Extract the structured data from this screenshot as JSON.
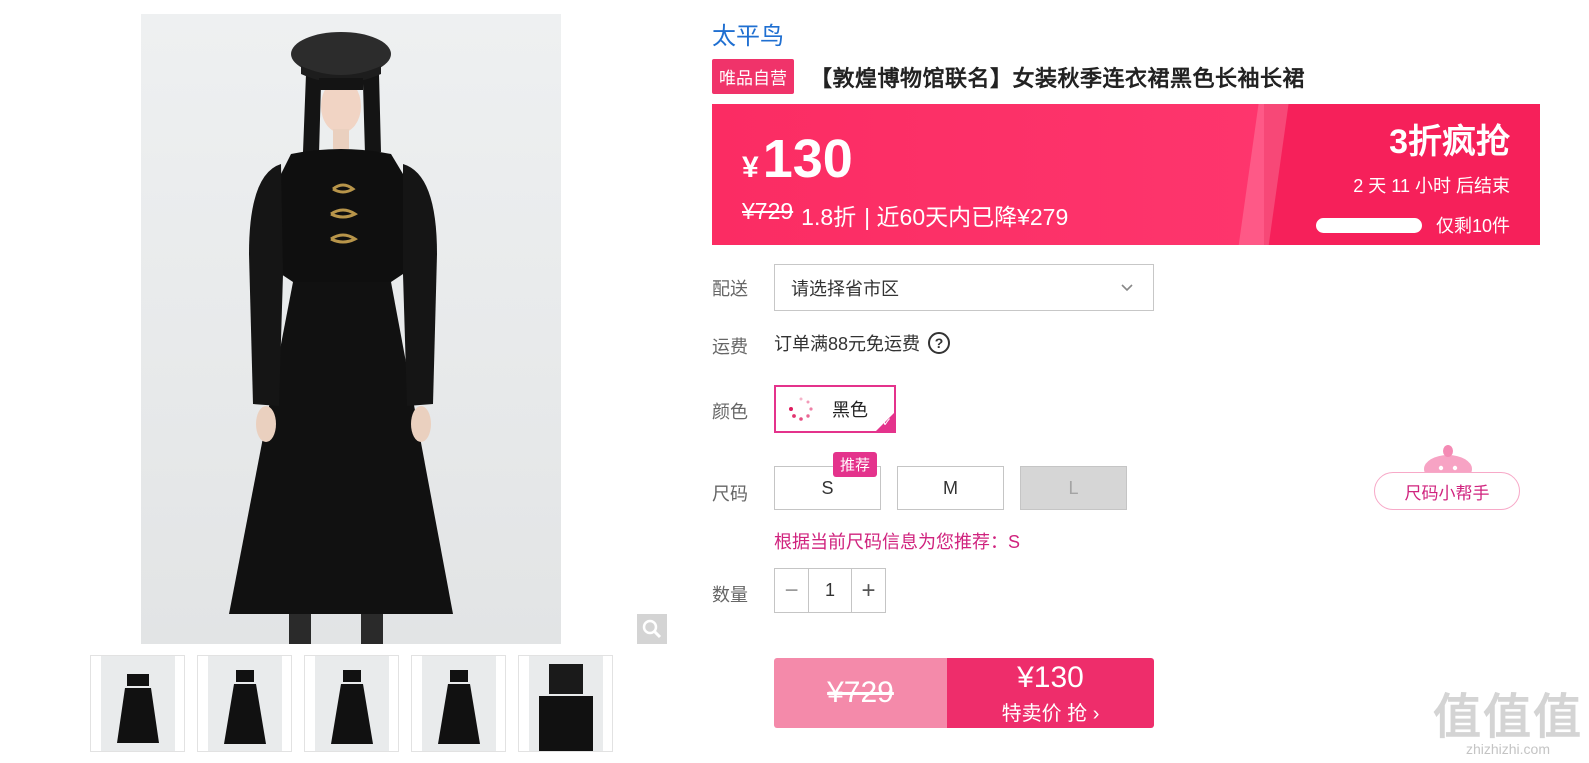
{
  "brand": "太平鸟",
  "product": {
    "self_badge": "唯品自营",
    "title": "【敦煌博物馆联名】女装秋季连衣裙黑色长袖长裙"
  },
  "price": {
    "currency": "¥",
    "current": "130",
    "original": "¥729",
    "discount": "1.8折",
    "recent_drop": "| 近60天内已降¥279",
    "promo_name": "3折疯抢",
    "countdown": "2 天 11 小时 后结束",
    "stock_remaining_fraction": 0.97,
    "stock_text": "仅剩10件"
  },
  "delivery": {
    "label": "配送",
    "placeholder": "请选择省市区"
  },
  "shipping": {
    "label": "运费",
    "text": "订单满88元免运费",
    "help_glyph": "?"
  },
  "color": {
    "label": "颜色",
    "selected": "黑色"
  },
  "size": {
    "label": "尺码",
    "options": [
      {
        "value": "S",
        "available": true
      },
      {
        "value": "M",
        "available": true
      },
      {
        "value": "L",
        "available": false
      }
    ],
    "recommend_badge": "推荐",
    "recommend_text": "根据当前尺码信息为您推荐：S",
    "helper_label": "尺码小帮手"
  },
  "quantity": {
    "label": "数量",
    "value": "1",
    "minus": "−",
    "plus": "+"
  },
  "buy": {
    "original": "¥729",
    "price": "¥130",
    "action": "特卖价 抢 ›"
  },
  "watermark": {
    "big": "值值值",
    "small": "zhizhizhi.com"
  },
  "colors": {
    "accent": "#ee2d6b",
    "brand_link": "#1f6fd1",
    "banner": "#fb2c63"
  }
}
